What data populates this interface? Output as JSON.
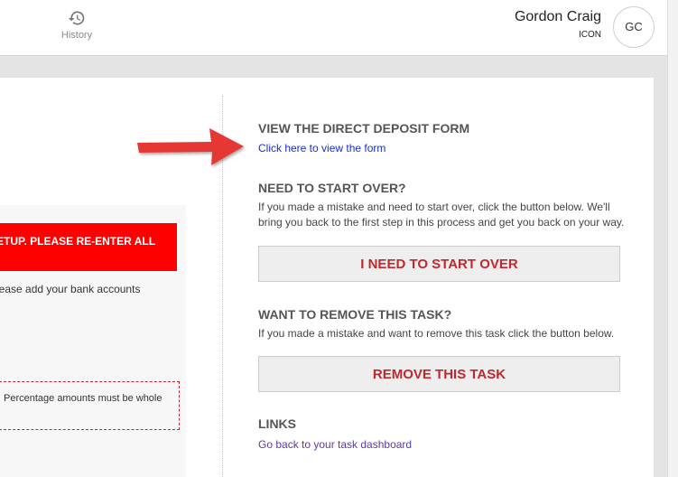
{
  "header": {
    "history_label": "History",
    "user_name": "Gordon Craig",
    "user_org": "ICON",
    "avatar_initials": "GC"
  },
  "left_panel": {
    "alert_text": "ETUP. PLEASE RE-ENTER ALL",
    "bank_text": "lease add your bank accounts",
    "percentage_note": "Percentage amounts must be whole"
  },
  "right_panel": {
    "view_form_heading": "VIEW THE DIRECT DEPOSIT FORM",
    "view_form_link": "Click here to view the form",
    "start_over_heading": "NEED TO START OVER?",
    "start_over_text": "If you made a mistake and need to start over, click the button below. We'll bring you back to the first step in this process and get you back on your way.",
    "start_over_button": "I NEED TO START OVER",
    "remove_heading": "WANT TO REMOVE THIS TASK?",
    "remove_text": "If you made a mistake and want to remove this task click the button below.",
    "remove_button": "REMOVE THIS TASK",
    "links_heading": "LINKS",
    "dashboard_link": "Go back to your task dashboard"
  },
  "colors": {
    "alert_red": "#fe0000",
    "button_text_red": "#c0282d",
    "arrow_red": "#e53935",
    "link_blue": "#1a2fc9",
    "link_purple": "#5a3e9a"
  },
  "icons": {
    "history": "history-icon",
    "annotation_arrow": "arrow-right-icon"
  }
}
